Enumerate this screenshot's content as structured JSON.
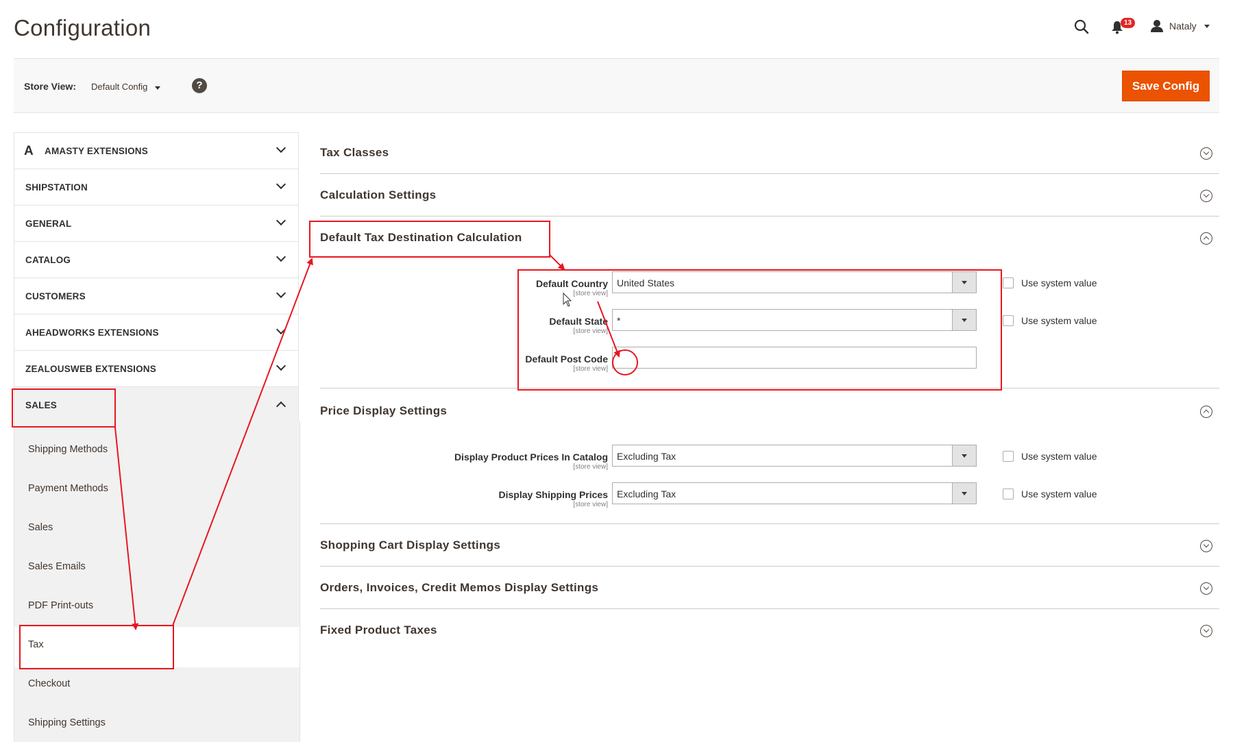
{
  "header": {
    "title": "Configuration",
    "search_icon": "search-icon",
    "notifications_icon": "bell-icon",
    "notifications_count": "13",
    "user_icon": "user-icon",
    "user_name": "Nataly"
  },
  "store_bar": {
    "label": "Store View:",
    "value": "Default Config",
    "help": "?",
    "save_label": "Save Config"
  },
  "sidebar": {
    "items": [
      {
        "label": "AMASTY EXTENSIONS",
        "logo": "A"
      },
      {
        "label": "SHIPSTATION"
      },
      {
        "label": "GENERAL"
      },
      {
        "label": "CATALOG"
      },
      {
        "label": "CUSTOMERS"
      },
      {
        "label": "AHEADWORKS EXTENSIONS"
      },
      {
        "label": "ZEALOUSWEB EXTENSIONS"
      },
      {
        "label": "SALES"
      }
    ],
    "sales_children": [
      "Shipping Methods",
      "Payment Methods",
      "Sales",
      "Sales Emails",
      "PDF Print-outs",
      "Tax",
      "Checkout",
      "Shipping Settings"
    ]
  },
  "sections": {
    "tax_classes": "Tax Classes",
    "calculation_settings": "Calculation Settings",
    "default_tax_destination": "Default Tax Destination Calculation",
    "price_display": "Price Display Settings",
    "shopping_cart_display": "Shopping Cart Display Settings",
    "orders_display": "Orders, Invoices, Credit Memos Display Settings",
    "fixed_product_taxes": "Fixed Product Taxes"
  },
  "fields": {
    "scope": "[store view]",
    "use_system_value": "Use system value",
    "default_country": {
      "label": "Default Country",
      "value": "United States"
    },
    "default_state": {
      "label": "Default State",
      "value": "*"
    },
    "default_post_code": {
      "label": "Default Post Code",
      "value": ""
    },
    "display_product_prices": {
      "label": "Display Product Prices In Catalog",
      "value": "Excluding Tax"
    },
    "display_shipping_prices": {
      "label": "Display Shipping Prices",
      "value": "Excluding Tax"
    }
  },
  "colors": {
    "accent": "#eb5202",
    "annotation": "#e8161f",
    "badge": "#e22626"
  }
}
